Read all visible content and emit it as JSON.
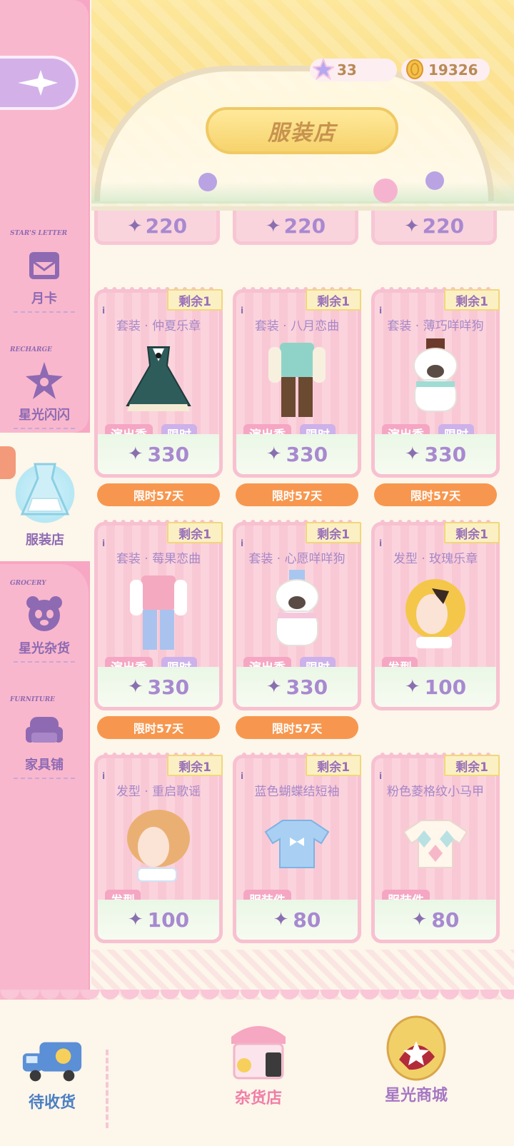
{
  "header": {
    "title": "服装店",
    "currency": [
      {
        "icon": "star-crystal-icon",
        "value": "33"
      },
      {
        "icon": "gold-coin-icon",
        "value": "19326"
      }
    ]
  },
  "sidebar": {
    "back_icon": "sparkle-back-icon",
    "items": [
      {
        "en": "STAR'S LETTER",
        "label": "月卡",
        "icon": "letter-box-icon"
      },
      {
        "en": "RECHARGE",
        "label": "星光闪闪",
        "icon": "flower-star-icon"
      },
      {
        "en": "",
        "label": "服装店",
        "icon": "dress-icon"
      },
      {
        "en": "GROCERY",
        "label": "星光杂货",
        "icon": "panda-icon"
      },
      {
        "en": "FURNITURE",
        "label": "家具铺",
        "icon": "sofa-icon"
      }
    ]
  },
  "top_row_prices": [
    "220",
    "220",
    "220"
  ],
  "products": [
    {
      "badge": "剩余1",
      "title": "套装 · 仲夏乐章",
      "tags": [
        "演出季",
        "限时"
      ],
      "price": "330",
      "timer": "限时57天",
      "art": "teal-dress"
    },
    {
      "badge": "剩余1",
      "title": "套装 · 八月恋曲",
      "tags": [
        "演出季",
        "限时"
      ],
      "price": "330",
      "timer": "限时57天",
      "art": "vest-suit"
    },
    {
      "badge": "剩余1",
      "title": "套装 · 薄巧咩咩狗",
      "tags": [
        "演出季",
        "限时"
      ],
      "price": "330",
      "timer": "限时57天",
      "art": "puppy-costume"
    },
    {
      "badge": "剩余1",
      "title": "套装 · 莓果恋曲",
      "tags": [
        "演出季",
        "限时"
      ],
      "price": "330",
      "timer": "限时57天",
      "art": "pink-vest-suit"
    },
    {
      "badge": "剩余1",
      "title": "套装 · 心愿咩咩狗",
      "tags": [
        "演出季",
        "限时"
      ],
      "price": "330",
      "timer": "限时57天",
      "art": "white-puppy"
    },
    {
      "badge": "剩余1",
      "title": "发型 · 玫瑰乐章",
      "tags": [
        "发型"
      ],
      "price": "100",
      "timer": "",
      "art": "blonde-hair"
    },
    {
      "badge": "剩余1",
      "title": "发型 · 重启歌谣",
      "tags": [
        "发型"
      ],
      "price": "100",
      "timer": "",
      "art": "orange-hair"
    },
    {
      "badge": "剩余1",
      "title": "蓝色蝴蝶结短袖",
      "tags": [
        "服装件"
      ],
      "price": "80",
      "timer": "",
      "art": "blue-tshirt"
    },
    {
      "badge": "剩余1",
      "title": "粉色菱格纹小马甲",
      "tags": [
        "服装件"
      ],
      "price": "80",
      "timer": "",
      "art": "argyle-vest"
    }
  ],
  "bottom_nav": [
    {
      "label": "待收货",
      "icon": "delivery-truck-icon"
    },
    {
      "label": "杂货店",
      "icon": "grocery-stall-icon"
    },
    {
      "label": "星光商城",
      "icon": "star-mall-icon"
    }
  ]
}
